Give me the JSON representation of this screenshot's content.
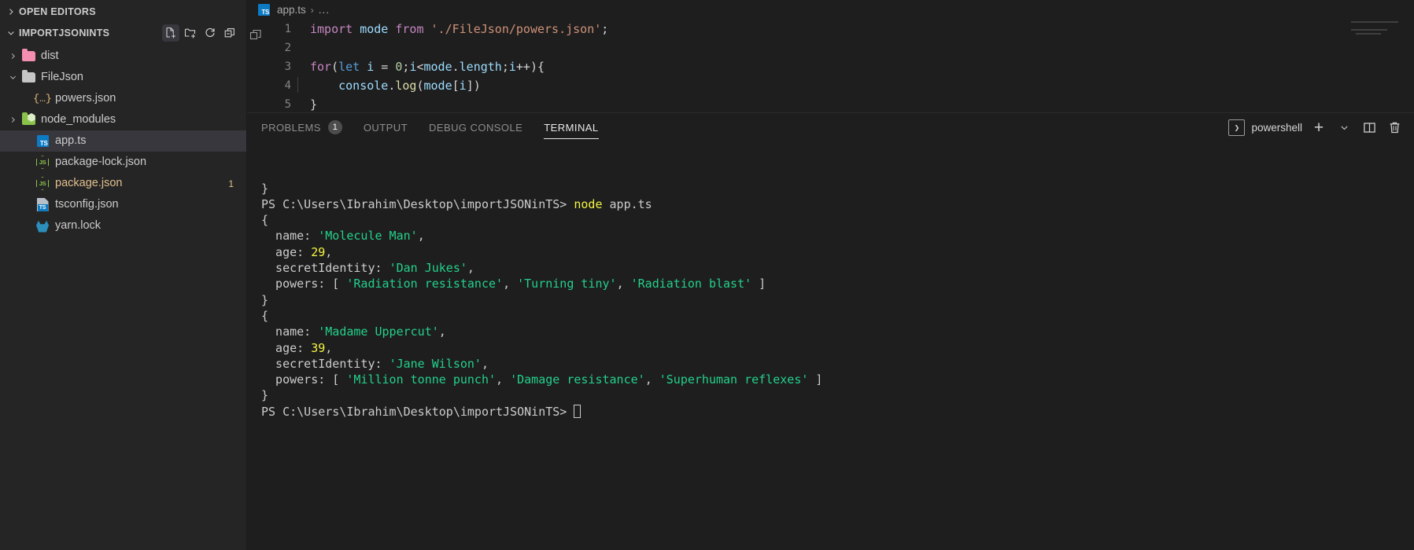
{
  "sidebar": {
    "open_editors_label": "OPEN EDITORS",
    "project_label": "IMPORTJSONINTS",
    "actions": [
      {
        "name": "new-file-icon",
        "title": "New File"
      },
      {
        "name": "new-folder-icon",
        "title": "New Folder"
      },
      {
        "name": "refresh-icon",
        "title": "Refresh Explorer"
      },
      {
        "name": "collapse-all-icon",
        "title": "Collapse Folders in Explorer"
      }
    ],
    "tree": [
      {
        "label": "dist",
        "type": "folder",
        "icon": "folder-pink-icon",
        "expanded": false,
        "indent": 1,
        "badge": ""
      },
      {
        "label": "FileJson",
        "type": "folder",
        "icon": "folder-grey-icon",
        "expanded": true,
        "indent": 1,
        "badge": ""
      },
      {
        "label": "powers.json",
        "type": "file",
        "icon": "json-icon",
        "indent": 2,
        "badge": ""
      },
      {
        "label": "node_modules",
        "type": "folder",
        "icon": "folder-node-icon",
        "expanded": false,
        "indent": 1,
        "badge": ""
      },
      {
        "label": "app.ts",
        "type": "file",
        "icon": "typescript-icon",
        "indent": 2,
        "badge": "",
        "selected": true
      },
      {
        "label": "package-lock.json",
        "type": "file",
        "icon": "nodejs-icon",
        "indent": 2,
        "badge": ""
      },
      {
        "label": "package.json",
        "type": "file",
        "icon": "nodejs-icon",
        "indent": 2,
        "badge": "1",
        "modified": true
      },
      {
        "label": "tsconfig.json",
        "type": "file",
        "icon": "tsconfig-icon",
        "indent": 2,
        "badge": ""
      },
      {
        "label": "yarn.lock",
        "type": "file",
        "icon": "yarn-icon",
        "indent": 2,
        "badge": ""
      }
    ]
  },
  "breadcrumb": {
    "file": "app.ts",
    "separator": "›",
    "dots": "..."
  },
  "editor": {
    "lines": [
      {
        "n": "1",
        "tokens": [
          {
            "t": "import",
            "c": "tok-kw"
          },
          {
            "t": " ",
            "c": "tok-plain"
          },
          {
            "t": "mode",
            "c": "tok-var"
          },
          {
            "t": " ",
            "c": "tok-plain"
          },
          {
            "t": "from",
            "c": "tok-kw"
          },
          {
            "t": " ",
            "c": "tok-plain"
          },
          {
            "t": "'./FileJson/powers.json'",
            "c": "tok-str"
          },
          {
            "t": ";",
            "c": "tok-plain"
          }
        ]
      },
      {
        "n": "2",
        "tokens": []
      },
      {
        "n": "3",
        "tokens": [
          {
            "t": "for",
            "c": "tok-kw"
          },
          {
            "t": "(",
            "c": "tok-plain"
          },
          {
            "t": "let",
            "c": "tok-kw2"
          },
          {
            "t": " ",
            "c": "tok-plain"
          },
          {
            "t": "i",
            "c": "tok-var"
          },
          {
            "t": " = ",
            "c": "tok-plain"
          },
          {
            "t": "0",
            "c": "tok-num"
          },
          {
            "t": ";",
            "c": "tok-plain"
          },
          {
            "t": "i",
            "c": "tok-var"
          },
          {
            "t": "<",
            "c": "tok-plain"
          },
          {
            "t": "mode",
            "c": "tok-var"
          },
          {
            "t": ".",
            "c": "tok-plain"
          },
          {
            "t": "length",
            "c": "tok-prop"
          },
          {
            "t": ";",
            "c": "tok-plain"
          },
          {
            "t": "i",
            "c": "tok-var"
          },
          {
            "t": "++){",
            "c": "tok-plain"
          }
        ]
      },
      {
        "n": "4",
        "tokens": [
          {
            "t": "    ",
            "c": "tok-plain"
          },
          {
            "t": "console",
            "c": "tok-var"
          },
          {
            "t": ".",
            "c": "tok-plain"
          },
          {
            "t": "log",
            "c": "tok-fn"
          },
          {
            "t": "(",
            "c": "tok-plain"
          },
          {
            "t": "mode",
            "c": "tok-var"
          },
          {
            "t": "[",
            "c": "tok-plain"
          },
          {
            "t": "i",
            "c": "tok-var"
          },
          {
            "t": "])",
            "c": "tok-plain"
          }
        ]
      },
      {
        "n": "5",
        "tokens": [
          {
            "t": "}",
            "c": "tok-plain"
          }
        ]
      }
    ]
  },
  "panel": {
    "tabs": [
      {
        "label": "PROBLEMS",
        "count": "1",
        "active": false
      },
      {
        "label": "OUTPUT",
        "count": "",
        "active": false
      },
      {
        "label": "DEBUG CONSOLE",
        "count": "",
        "active": false
      },
      {
        "label": "TERMINAL",
        "count": "",
        "active": true
      }
    ],
    "shell_label": "powershell",
    "shell_icon_glyph": "❯",
    "actions": [
      {
        "name": "new-terminal-button",
        "glyph": "+"
      },
      {
        "name": "terminal-dropdown-button",
        "glyph": "⌄"
      },
      {
        "name": "split-terminal-button",
        "glyph": "split"
      },
      {
        "name": "kill-terminal-button",
        "glyph": "trash"
      }
    ]
  },
  "terminal": {
    "lines": [
      [
        {
          "t": "}",
          "c": "t-white"
        }
      ],
      [
        {
          "t": "PS C:\\Users\\Ibrahim\\Desktop\\importJSONinTS> ",
          "c": "t-white"
        },
        {
          "t": "node",
          "c": "t-yellow"
        },
        {
          "t": " app.ts",
          "c": "t-white"
        }
      ],
      [
        {
          "t": "{",
          "c": "t-white"
        }
      ],
      [
        {
          "t": "  name: ",
          "c": "t-white"
        },
        {
          "t": "'Molecule Man'",
          "c": "t-green"
        },
        {
          "t": ",",
          "c": "t-white"
        }
      ],
      [
        {
          "t": "  age: ",
          "c": "t-white"
        },
        {
          "t": "29",
          "c": "t-yellow"
        },
        {
          "t": ",",
          "c": "t-white"
        }
      ],
      [
        {
          "t": "  secretIdentity: ",
          "c": "t-white"
        },
        {
          "t": "'Dan Jukes'",
          "c": "t-green"
        },
        {
          "t": ",",
          "c": "t-white"
        }
      ],
      [
        {
          "t": "  powers: [ ",
          "c": "t-white"
        },
        {
          "t": "'Radiation resistance'",
          "c": "t-green"
        },
        {
          "t": ", ",
          "c": "t-white"
        },
        {
          "t": "'Turning tiny'",
          "c": "t-green"
        },
        {
          "t": ", ",
          "c": "t-white"
        },
        {
          "t": "'Radiation blast'",
          "c": "t-green"
        },
        {
          "t": " ]",
          "c": "t-white"
        }
      ],
      [
        {
          "t": "}",
          "c": "t-white"
        }
      ],
      [
        {
          "t": "{",
          "c": "t-white"
        }
      ],
      [
        {
          "t": "  name: ",
          "c": "t-white"
        },
        {
          "t": "'Madame Uppercut'",
          "c": "t-green"
        },
        {
          "t": ",",
          "c": "t-white"
        }
      ],
      [
        {
          "t": "  age: ",
          "c": "t-white"
        },
        {
          "t": "39",
          "c": "t-yellow"
        },
        {
          "t": ",",
          "c": "t-white"
        }
      ],
      [
        {
          "t": "  secretIdentity: ",
          "c": "t-white"
        },
        {
          "t": "'Jane Wilson'",
          "c": "t-green"
        },
        {
          "t": ",",
          "c": "t-white"
        }
      ],
      [
        {
          "t": "  powers: [ ",
          "c": "t-white"
        },
        {
          "t": "'Million tonne punch'",
          "c": "t-green"
        },
        {
          "t": ", ",
          "c": "t-white"
        },
        {
          "t": "'Damage resistance'",
          "c": "t-green"
        },
        {
          "t": ", ",
          "c": "t-white"
        },
        {
          "t": "'Superhuman reflexes'",
          "c": "t-green"
        },
        {
          "t": " ]",
          "c": "t-white"
        }
      ],
      [
        {
          "t": "}",
          "c": "t-white"
        }
      ],
      [
        {
          "t": "PS C:\\Users\\Ibrahim\\Desktop\\importJSONinTS> ",
          "c": "t-white"
        },
        {
          "t": "__CURSOR__",
          "c": "cursor"
        }
      ]
    ]
  },
  "colors": {
    "background": "#1e1e1e",
    "sidebar": "#252526",
    "selection": "#37373d",
    "accent_blue": "#0d7bc4",
    "terminal_green": "#23d18b",
    "terminal_yellow": "#f5f543",
    "modified_badge": "#e2c08d"
  }
}
